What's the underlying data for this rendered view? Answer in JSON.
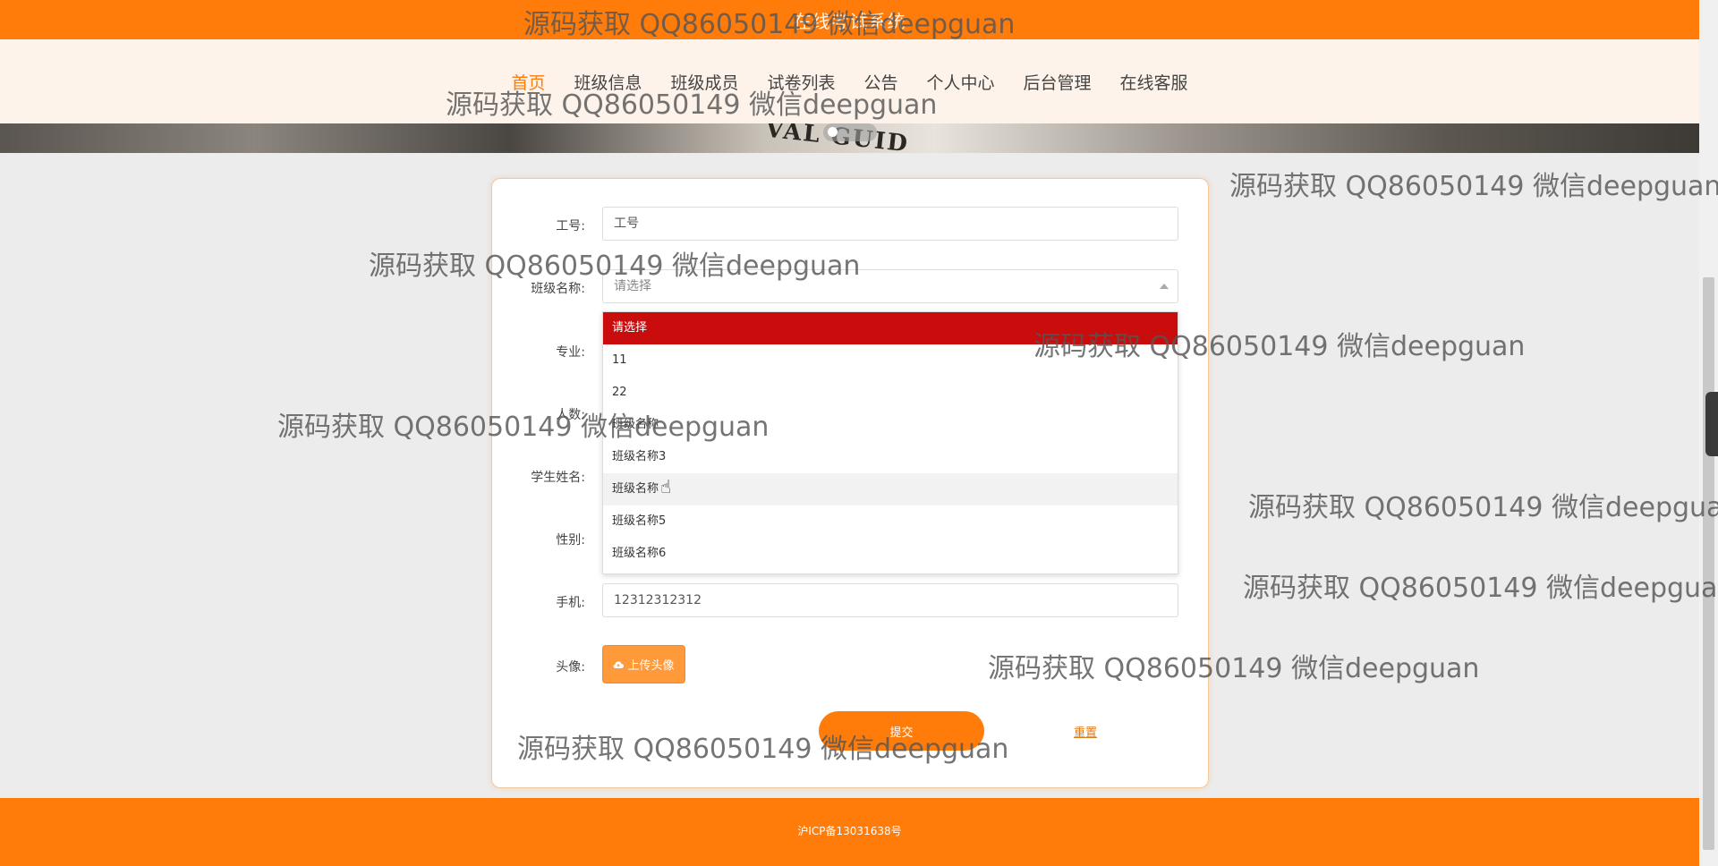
{
  "header": {
    "title": "在线考试系统"
  },
  "nav": {
    "items": [
      {
        "label": "首页",
        "active": true
      },
      {
        "label": "班级信息"
      },
      {
        "label": "班级成员"
      },
      {
        "label": "试卷列表"
      },
      {
        "label": "公告"
      },
      {
        "label": "个人中心"
      },
      {
        "label": "后台管理"
      },
      {
        "label": "在线客服"
      }
    ]
  },
  "banner": {
    "text": "VAL GUID"
  },
  "form": {
    "gonghao_label": "工号:",
    "gonghao_placeholder": "工号",
    "class_label": "班级名称:",
    "class_placeholder": "请选择",
    "major_label": "专业:",
    "count_label": "人数:",
    "student_label": "学生姓名:",
    "gender_label": "性别:",
    "phone_label": "手机:",
    "phone_value": "12312312312",
    "avatar_label": "头像:",
    "upload_label": "上传头像",
    "submit_label": "提交",
    "reset_label": "重置"
  },
  "dropdown": {
    "options": [
      "请选择",
      "11",
      "22",
      "班级名称",
      "班级名称3",
      "班级名称",
      "班级名称5",
      "班级名称6"
    ]
  },
  "footer": {
    "text": "沪ICP备13031638号"
  },
  "watermark": "源码获取 QQ86050149 微信deepguan",
  "colors": {
    "primary": "#ff7b0a",
    "selected": "#c90c0c"
  }
}
